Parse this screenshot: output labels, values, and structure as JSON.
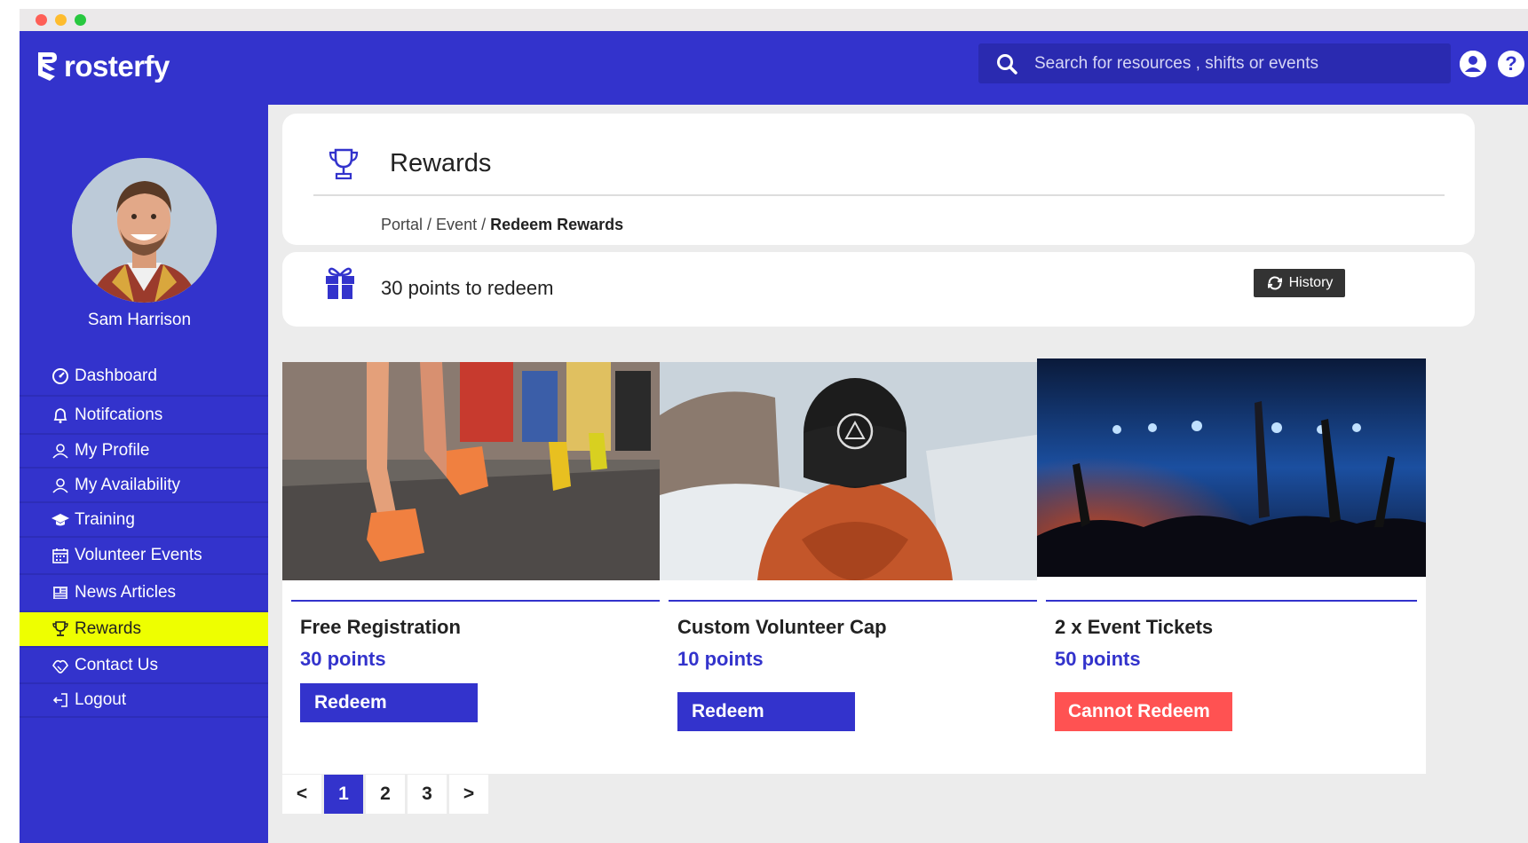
{
  "app": {
    "brand": "rosterfy",
    "accent": "#3333cc",
    "highlight": "#eeff00"
  },
  "search": {
    "placeholder": "Search for resources , shifts or events"
  },
  "user": {
    "name": "Sam Harrison"
  },
  "sidebar": {
    "items": [
      {
        "label": "Dashboard",
        "icon": "dashboard-icon",
        "active": false
      },
      {
        "label": "Notifcations",
        "icon": "bell-icon",
        "active": false
      },
      {
        "label": "My Profile",
        "icon": "user-icon",
        "active": false
      },
      {
        "label": "My Availability",
        "icon": "user-icon",
        "active": false
      },
      {
        "label": "Training",
        "icon": "graduation-cap-icon",
        "active": false
      },
      {
        "label": "Volunteer Events",
        "icon": "calendar-icon",
        "active": false
      },
      {
        "label": "News Articles",
        "icon": "newspaper-icon",
        "active": false
      },
      {
        "label": "Rewards",
        "icon": "trophy-icon",
        "active": true
      },
      {
        "label": "Contact Us",
        "icon": "handshake-icon",
        "active": false
      },
      {
        "label": "Logout",
        "icon": "logout-icon",
        "active": false
      }
    ]
  },
  "page": {
    "title": "Rewards",
    "breadcrumb": {
      "part1": "Portal",
      "sep1": " / ",
      "part2": "Event",
      "sep2": " / ",
      "current": "Redeem Rewards"
    }
  },
  "points": {
    "text": "30 points to redeem",
    "history_label": "History"
  },
  "rewards": [
    {
      "title": "Free Registration",
      "points": "30 points",
      "button": "Redeem",
      "status": "available",
      "image": "runners-photo"
    },
    {
      "title": "Custom Volunteer Cap",
      "points": "10 points",
      "button": "Redeem",
      "status": "available",
      "image": "cap-photo"
    },
    {
      "title": "2 x Event Tickets",
      "points": "50 points",
      "button": "Cannot Redeem",
      "status": "unavailable",
      "image": "concert-photo"
    }
  ],
  "pagination": {
    "prev": "<",
    "pages": [
      "1",
      "2",
      "3"
    ],
    "current": "1",
    "next": ">"
  }
}
